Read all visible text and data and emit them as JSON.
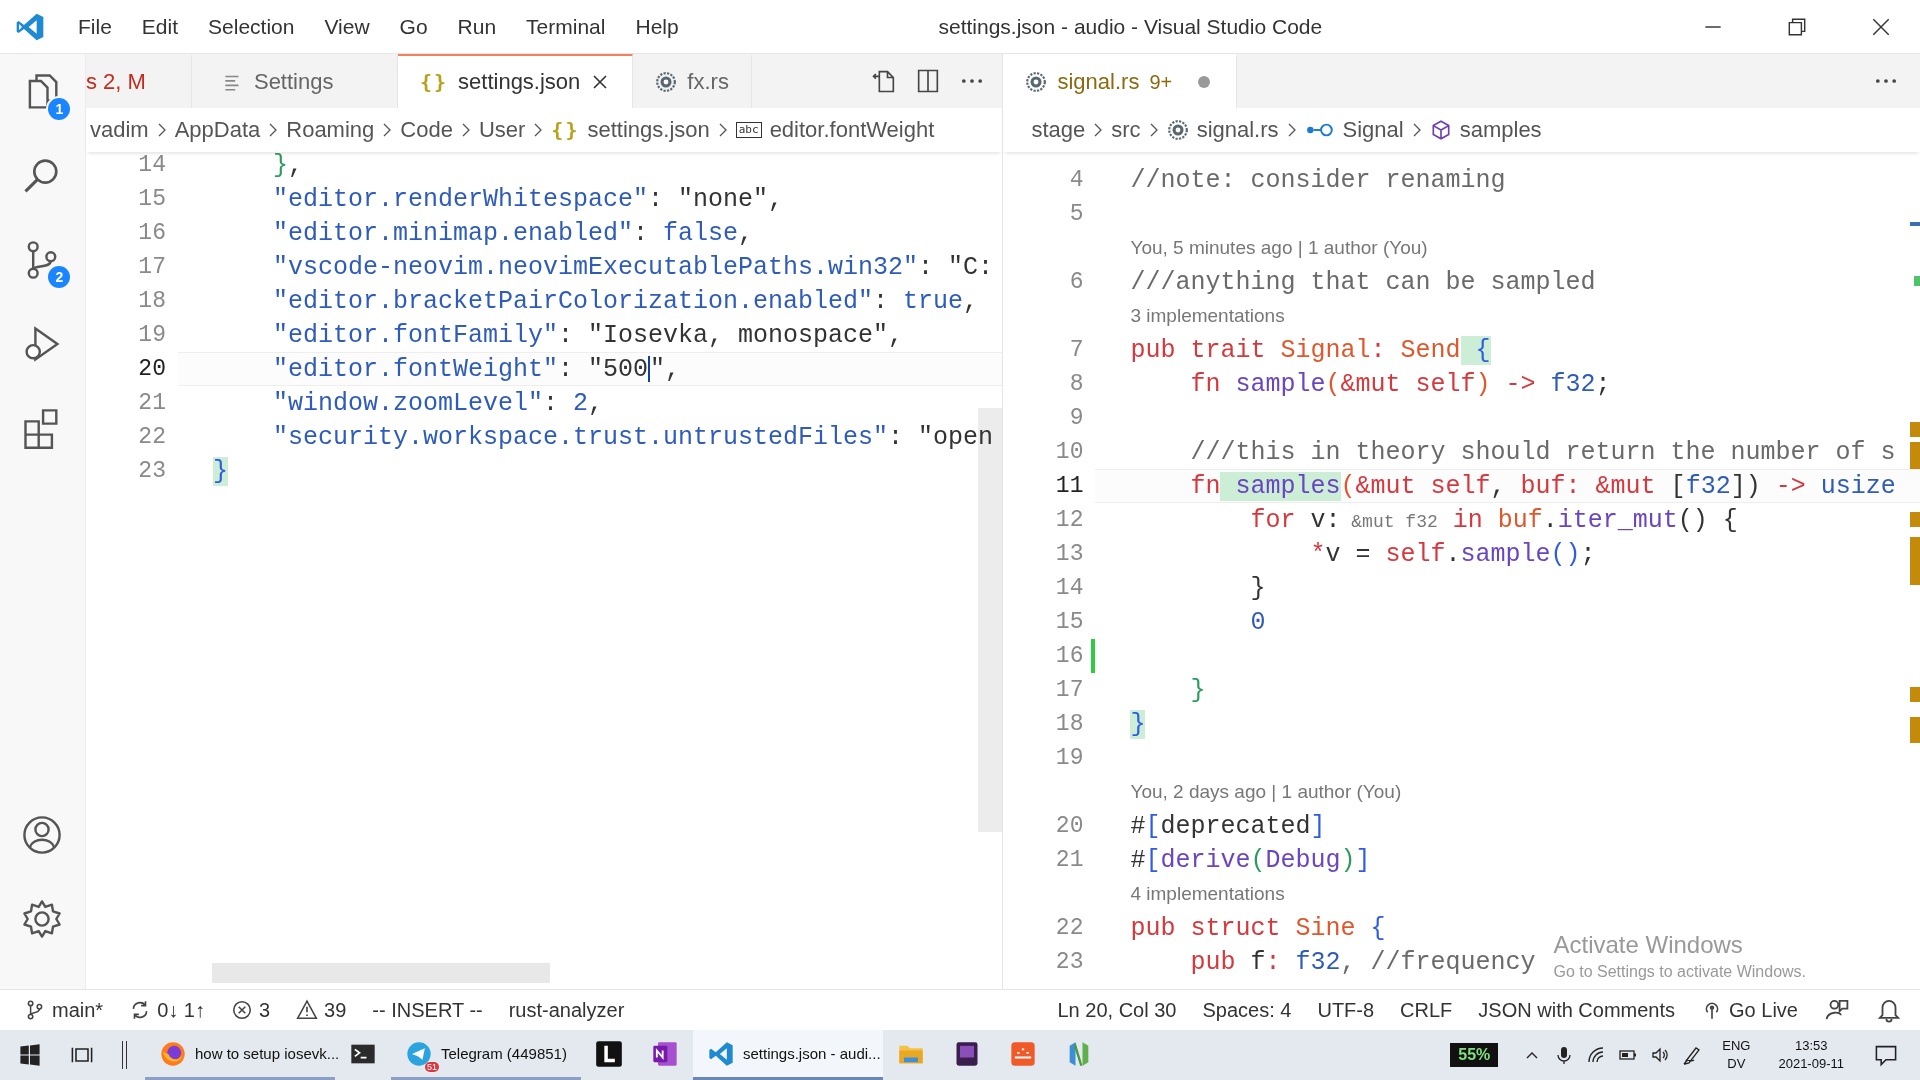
{
  "window": {
    "title": "settings.json - audio - Visual Studio Code"
  },
  "menu": [
    "File",
    "Edit",
    "Selection",
    "View",
    "Go",
    "Run",
    "Terminal",
    "Help"
  ],
  "activity_bar": {
    "top": [
      {
        "kind": "explorer",
        "badge": "1"
      },
      {
        "kind": "search"
      },
      {
        "kind": "scm",
        "badge": "2"
      },
      {
        "kind": "debug"
      },
      {
        "kind": "extensions"
      }
    ],
    "bottom": [
      {
        "kind": "account"
      },
      {
        "kind": "settings"
      }
    ]
  },
  "left_group": {
    "focused": true,
    "tabs": [
      {
        "label": "s 2, M",
        "kind": "plain",
        "has_errors": true,
        "selected": false
      },
      {
        "label": "Settings",
        "kind": "settings",
        "has_errors": false,
        "selected": false
      },
      {
        "label": "settings.json",
        "kind": "json",
        "icon_text": "{}",
        "has_errors": false,
        "selected": true
      },
      {
        "label": "fx.rs",
        "kind": "rust",
        "has_errors": false,
        "selected": false
      }
    ],
    "breadcrumbs": [
      {
        "label": "vadim",
        "kind": "plain"
      },
      {
        "label": "AppData",
        "kind": "plain"
      },
      {
        "label": "Roaming",
        "kind": "plain"
      },
      {
        "label": "Code",
        "kind": "plain"
      },
      {
        "label": "User",
        "kind": "plain"
      },
      {
        "label": "settings.json",
        "kind": "json",
        "icon_text": "{}"
      },
      {
        "label": "editor.fontWeight",
        "kind": "string",
        "icon_text": "abc"
      }
    ],
    "rows": [
      {
        "kind": "code",
        "number": "14",
        "current": false,
        "tokens": [
          {
            "text": "    }",
            "kind": "b2"
          },
          {
            "text": ",",
            "kind": "p"
          }
        ]
      },
      {
        "kind": "code",
        "number": "15",
        "current": false,
        "tokens": [
          {
            "text": "    \"editor.renderWhitespace\"",
            "kind": "key"
          },
          {
            "text": ": ",
            "kind": "p"
          },
          {
            "text": "\"none\"",
            "kind": "str"
          },
          {
            "text": ",",
            "kind": "p"
          }
        ]
      },
      {
        "kind": "code",
        "number": "16",
        "current": false,
        "tokens": [
          {
            "text": "    \"editor.minimap.enabled\"",
            "kind": "key"
          },
          {
            "text": ": ",
            "kind": "p"
          },
          {
            "text": "false",
            "kind": "lit"
          },
          {
            "text": ",",
            "kind": "p"
          }
        ]
      },
      {
        "kind": "code",
        "number": "17",
        "current": false,
        "tokens": [
          {
            "text": "    \"vscode-neovim.neovimExecutablePaths.win32\"",
            "kind": "key"
          },
          {
            "text": ": ",
            "kind": "p"
          },
          {
            "text": "\"C:",
            "kind": "str"
          }
        ]
      },
      {
        "kind": "code",
        "number": "18",
        "current": false,
        "tokens": [
          {
            "text": "    \"editor.bracketPairColorization.enabled\"",
            "kind": "key"
          },
          {
            "text": ": ",
            "kind": "p"
          },
          {
            "text": "true",
            "kind": "lit"
          },
          {
            "text": ",",
            "kind": "p"
          }
        ]
      },
      {
        "kind": "code",
        "number": "19",
        "current": false,
        "tokens": [
          {
            "text": "    \"editor.fontFamily\"",
            "kind": "key"
          },
          {
            "text": ": ",
            "kind": "p"
          },
          {
            "text": "\"Iosevka, monospace\"",
            "kind": "str"
          },
          {
            "text": ",",
            "kind": "p"
          }
        ]
      },
      {
        "kind": "code",
        "number": "20",
        "current": true,
        "tokens": [
          {
            "text": "    \"editor.fontWeight\"",
            "kind": "key"
          },
          {
            "text": ": ",
            "kind": "p"
          },
          {
            "text": "\"500",
            "kind": "strc"
          },
          {
            "text": "\"",
            "kind": "str"
          },
          {
            "text": ",",
            "kind": "p"
          }
        ]
      },
      {
        "kind": "code",
        "number": "21",
        "current": false,
        "tokens": [
          {
            "text": "    \"window.zoomLevel\"",
            "kind": "key"
          },
          {
            "text": ": ",
            "kind": "p"
          },
          {
            "text": "2",
            "kind": "lit"
          },
          {
            "text": ",",
            "kind": "p"
          }
        ]
      },
      {
        "kind": "code",
        "number": "22",
        "current": false,
        "tokens": [
          {
            "text": "    \"security.workspace.trust.untrustedFiles\"",
            "kind": "key"
          },
          {
            "text": ": ",
            "kind": "p"
          },
          {
            "text": "\"open",
            "kind": "str"
          }
        ]
      },
      {
        "kind": "code",
        "number": "23",
        "current": false,
        "tokens": [
          {
            "text": "}",
            "kind": "b1m"
          }
        ]
      }
    ]
  },
  "right_group": {
    "focused": false,
    "tabs": [
      {
        "label": "signal.rs",
        "suffix": "9+",
        "kind": "rust",
        "has_warnings": true,
        "dirty": true,
        "selected": true
      }
    ],
    "breadcrumbs": [
      {
        "label": "stage",
        "kind": "plain"
      },
      {
        "label": "src",
        "kind": "plain"
      },
      {
        "label": "signal.rs",
        "kind": "rust"
      },
      {
        "label": "Signal",
        "kind": "interface"
      },
      {
        "label": "samples",
        "kind": "method"
      }
    ],
    "rows": [
      {
        "kind": "code",
        "number": "4",
        "current": false,
        "tokens": [
          {
            "text": "//note: consider renaming",
            "kind": "com"
          }
        ]
      },
      {
        "kind": "code",
        "number": "5",
        "current": false
      },
      {
        "kind": "lens",
        "text": "You, 5 minutes ago | 1 author (You)"
      },
      {
        "kind": "code",
        "number": "6",
        "current": false,
        "tokens": [
          {
            "text": "///anything that can be sampled",
            "kind": "com"
          }
        ]
      },
      {
        "kind": "lens",
        "text": "3 implementations"
      },
      {
        "kind": "code",
        "number": "7",
        "current": false,
        "tokens": [
          {
            "text": "pub trait ",
            "kind": "kw"
          },
          {
            "text": "Signal",
            "kind": "ty"
          },
          {
            "text": ": ",
            "kind": "kw"
          },
          {
            "text": "Send",
            "kind": "ty"
          },
          {
            "text": " {",
            "kind": "b1m"
          }
        ]
      },
      {
        "kind": "code",
        "number": "8",
        "current": false,
        "tokens": [
          {
            "text": "    fn",
            "kind": "kw"
          },
          {
            "text": " sample",
            "kind": "fn"
          },
          {
            "text": "(",
            "kind": "ty"
          },
          {
            "text": "&mut self",
            "kind": "kw"
          },
          {
            "text": ")",
            "kind": "ty"
          },
          {
            "text": " ->",
            "kind": "kw"
          },
          {
            "text": " f32",
            "kind": "lit"
          },
          {
            "text": ";",
            "kind": "p"
          }
        ]
      },
      {
        "kind": "code",
        "number": "9",
        "current": false
      },
      {
        "kind": "code",
        "number": "10",
        "current": false,
        "tokens": [
          {
            "text": "    ///this in theory should return the number of s",
            "kind": "com"
          }
        ]
      },
      {
        "kind": "code",
        "number": "11",
        "current": true,
        "tokens": [
          {
            "text": "    fn",
            "kind": "kw"
          },
          {
            "text": " samples",
            "kind": "fnm"
          },
          {
            "text": "(",
            "kind": "ty"
          },
          {
            "text": "&mut self",
            "kind": "kw"
          },
          {
            "text": ",",
            "kind": "p"
          },
          {
            "text": " buf: &mut",
            "kind": "kw"
          },
          {
            "text": " [",
            "kind": "p"
          },
          {
            "text": "f32",
            "kind": "lit"
          },
          {
            "text": "])",
            "kind": "p"
          },
          {
            "text": " ->",
            "kind": "kw"
          },
          {
            "text": " usize",
            "kind": "lit"
          }
        ]
      },
      {
        "kind": "code",
        "number": "12",
        "current": false,
        "tokens": [
          {
            "text": "        for",
            "kind": "kw"
          },
          {
            "text": " v:",
            "kind": "p"
          },
          {
            "text": " &mut f32",
            "kind": "hint"
          },
          {
            "text": " in",
            "kind": "kw"
          },
          {
            "text": " buf",
            "kind": "ty"
          },
          {
            "text": ".",
            "kind": "p"
          },
          {
            "text": "iter_mut",
            "kind": "fn"
          },
          {
            "text": "() {",
            "kind": "p"
          }
        ]
      },
      {
        "kind": "code",
        "number": "13",
        "current": false,
        "tokens": [
          {
            "text": "            *",
            "kind": "kw"
          },
          {
            "text": "v =",
            "kind": "p"
          },
          {
            "text": " self",
            "kind": "kw"
          },
          {
            "text": ".",
            "kind": "p"
          },
          {
            "text": "sample",
            "kind": "fn"
          },
          {
            "text": "()",
            "kind": "b1"
          },
          {
            "text": ";",
            "kind": "p"
          }
        ]
      },
      {
        "kind": "code",
        "number": "14",
        "current": false,
        "tokens": [
          {
            "text": "        }",
            "kind": "p"
          }
        ]
      },
      {
        "kind": "code",
        "number": "15",
        "current": false,
        "tokens": [
          {
            "text": "        0",
            "kind": "lit"
          }
        ]
      },
      {
        "kind": "code",
        "number": "16",
        "current": false,
        "git_added": true
      },
      {
        "kind": "code",
        "number": "17",
        "current": false,
        "tokens": [
          {
            "text": "    }",
            "kind": "b2"
          }
        ]
      },
      {
        "kind": "code",
        "number": "18",
        "current": false,
        "tokens": [
          {
            "text": "}",
            "kind": "b1m"
          }
        ]
      },
      {
        "kind": "code",
        "number": "19",
        "current": false
      },
      {
        "kind": "lens",
        "text": "You, 2 days ago | 1 author (You)"
      },
      {
        "kind": "code",
        "number": "20",
        "current": false,
        "tokens": [
          {
            "text": "#",
            "kind": "p"
          },
          {
            "text": "[",
            "kind": "b1"
          },
          {
            "text": "deprecated",
            "kind": "p"
          },
          {
            "text": "]",
            "kind": "b1"
          }
        ]
      },
      {
        "kind": "code",
        "number": "21",
        "current": false,
        "tokens": [
          {
            "text": "#",
            "kind": "p"
          },
          {
            "text": "[",
            "kind": "b1"
          },
          {
            "text": "derive",
            "kind": "fn"
          },
          {
            "text": "(",
            "kind": "b2"
          },
          {
            "text": "Debug",
            "kind": "fn"
          },
          {
            "text": ")",
            "kind": "b2"
          },
          {
            "text": "]",
            "kind": "b1"
          }
        ]
      },
      {
        "kind": "lens",
        "text": "4 implementations"
      },
      {
        "kind": "code",
        "number": "22",
        "current": false,
        "tokens": [
          {
            "text": "pub struct ",
            "kind": "kw"
          },
          {
            "text": "Sine",
            "kind": "ty"
          },
          {
            "text": " {",
            "kind": "b1"
          }
        ]
      },
      {
        "kind": "code",
        "number": "23",
        "current": false,
        "tokens": [
          {
            "text": "    pub ",
            "kind": "kw"
          },
          {
            "text": "f",
            "kind": "p"
          },
          {
            "text": ": ",
            "kind": "kw"
          },
          {
            "text": "f32",
            "kind": "lit"
          },
          {
            "text": ", //frequency",
            "kind": "com"
          }
        ]
      }
    ]
  },
  "activation_notice": {
    "title": "Activate Windows",
    "text": "Go to Settings to activate Windows."
  },
  "status_bar": {
    "left": [
      {
        "kind": "branch",
        "text": "main*"
      },
      {
        "kind": "sync",
        "text": "0↓ 1↑"
      },
      {
        "kind": "errors",
        "text": "3"
      },
      {
        "kind": "warnings",
        "text": "39"
      },
      {
        "kind": "plain",
        "text": "-- INSERT --"
      },
      {
        "kind": "plain",
        "text": "rust-analyzer"
      }
    ],
    "right": [
      {
        "kind": "plain",
        "text": "Ln 20, Col 30"
      },
      {
        "kind": "plain",
        "text": "Spaces: 4"
      },
      {
        "kind": "plain",
        "text": "UTF-8"
      },
      {
        "kind": "plain",
        "text": "CRLF"
      },
      {
        "kind": "plain",
        "text": "JSON with Comments"
      },
      {
        "kind": "live",
        "text": "Go Live"
      },
      {
        "kind": "feedback"
      },
      {
        "kind": "bell"
      }
    ]
  },
  "taskbar": {
    "apps": [
      {
        "kind": "firefox",
        "label": "how to setup iosevk...",
        "running": true,
        "selected": false
      },
      {
        "kind": "terminal",
        "running": false,
        "selected": false
      },
      {
        "kind": "telegram",
        "label": "Telegram (449851)",
        "badge": "51",
        "running": true,
        "selected": false
      },
      {
        "kind": "letter-l",
        "running": false,
        "selected": false
      },
      {
        "kind": "onenote",
        "running": false,
        "selected": false
      },
      {
        "kind": "vscode",
        "label": "settings.json - audi...",
        "running": true,
        "selected": true
      },
      {
        "kind": "folder",
        "running": false,
        "selected": false
      },
      {
        "kind": "purple",
        "running": false,
        "selected": false
      },
      {
        "kind": "orange",
        "running": false,
        "selected": false
      },
      {
        "kind": "neovim",
        "running": false,
        "selected": false
      }
    ],
    "battery": "55%",
    "language": "ENG",
    "layout": "DV",
    "time": "13:53",
    "date": "2021-09-11"
  }
}
